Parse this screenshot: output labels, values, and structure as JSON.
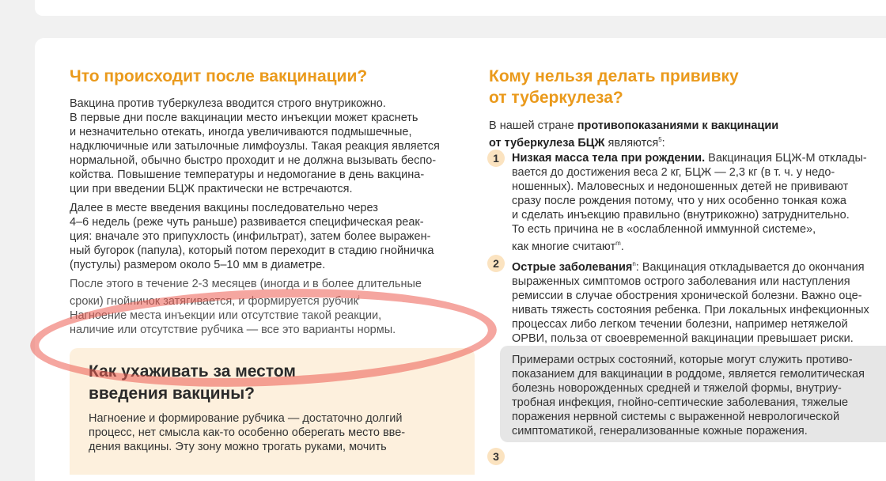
{
  "left": {
    "heading": "Что происходит после вакцинации?",
    "p1": [
      "Вакцина против туберкулеза вводится строго внутрикожно.",
      "В первые дни после вакцинации место инъекции может краснеть",
      "и незначительно отекать, иногда увеличиваются подмышечные,",
      "надключичные или затылочные лимфоузлы. Такая реакция является",
      "нормальной, обычно быстро проходит и не должна вызывать беспо-",
      "койства. Повышение температуры и недомогание в день вакцина-",
      "ции при введении БЦЖ практически не встречаются."
    ],
    "p2": [
      "Далее в месте введения вакцины последовательно через",
      "4–6 недель (реже чуть раньше) развивается специфическая реак-",
      "ция: вначале это припухлость (инфильтрат), затем более выражен-",
      "ный бугорок (папула), который потом переходит в стадию гнойничка",
      "(пустулы) размером около 5–10 мм в диаметре."
    ],
    "p3": [
      "После этого в течение 2-3 месяцев (иногда и в более длительные",
      "сроки) гнойничок затягивается, и формируется рубчик",
      "Нагноение места инъекции или отсутствие такой реакции,",
      "наличие или отсутствие рубчика — все это варианты нормы."
    ],
    "p3_ref": "i",
    "care_box": {
      "title_line1": "Как ухаживать за местом",
      "title_line2": "введения вакцины?",
      "text": [
        "Нагноение и формирование рубчика — достаточно долгий",
        "процесс, нет смысла как-то особенно оберегать место вве-",
        "дения вакцины. Эту зону можно трогать руками, мочить"
      ]
    }
  },
  "right": {
    "heading_line1": "Кому нельзя делать прививку",
    "heading_line2": "от туберкулеза?",
    "intro_prefix": "В нашей стране",
    "intro_bold1": "противопоказаниями к вакцинации",
    "intro_bold2": "от туберкулеза БЦЖ",
    "intro_suffix": "являются",
    "intro_ref": "5",
    "items": [
      {
        "num": "1",
        "bold": "Низкая масса тела при рождении.",
        "first_rest": "Вакцинация БЦЖ-М отклады-",
        "lines": [
          "вается до достижения веса 2 кг, БЦЖ — 2,3 кг (в т. ч. у недо-",
          "ношенных). Маловесных и недоношенных детей не прививают",
          "сразу после рождения потому, что у них особенно тонкая кожа",
          "и сделать инъекцию правильно (внутрикожно) затруднительно.",
          "То есть причина не в «ослабленной иммунной системе»,",
          "как многие считают"
        ],
        "ref": "m"
      },
      {
        "num": "2",
        "bold": "Острые заболевания",
        "ref": "n",
        "first_rest": ": Вакцинация откладывается до окончания",
        "lines": [
          "выраженных симптомов острого заболевания или наступления",
          "ремиссии в случае обострения хронической болезни. Важно оце-",
          "нивать тяжесть состояния ребенка. При локальных инфекционных",
          "процессах либо легком течении болезни, например нетяжелой",
          "ОРВИ, польза от своевременной вакцинации превышает риски."
        ]
      }
    ],
    "gray_box": [
      "Примерами острых состояний, которые могут служить противо-",
      "показанием для вакцинации в роддоме, является гемолитическая",
      "болезнь новорожденных средней и тяжелой формы, внутриу-",
      "тробная инфекция, гнойно-септические заболевания, тяжелые",
      "поражения нервной системы с выраженной неврологической",
      "симптоматикой, генерализованные кожные поражения."
    ],
    "next_num": "3"
  }
}
